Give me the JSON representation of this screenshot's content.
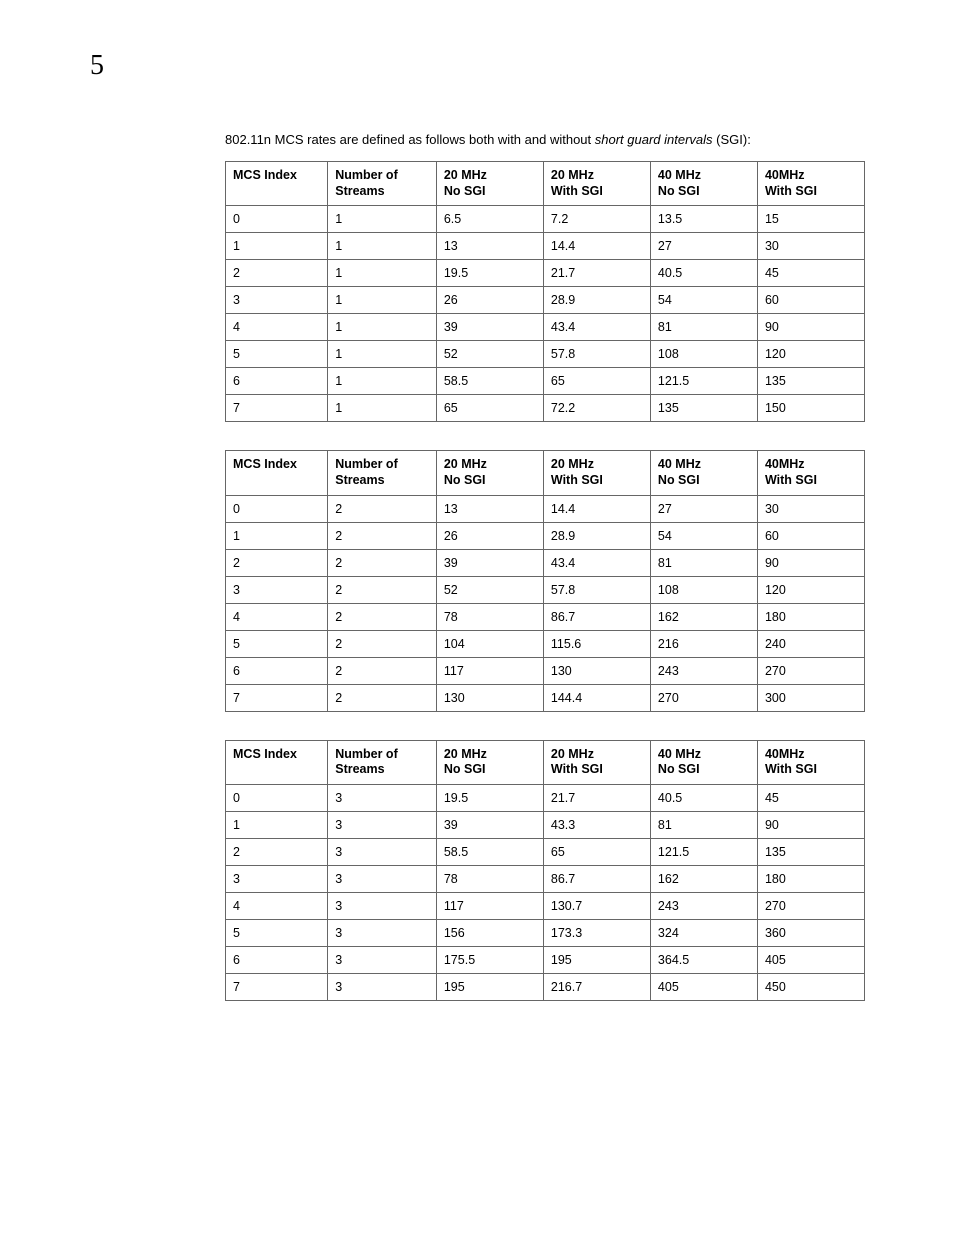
{
  "page_number": "5",
  "intro_prefix": "802.11n MCS rates are defined as follows both with and without ",
  "intro_em": "short guard intervals",
  "intro_suffix": " (SGI):",
  "columns": [
    {
      "l1": "MCS Index",
      "l2": ""
    },
    {
      "l1": "Number of Streams",
      "l2": ""
    },
    {
      "l1": "20 MHz",
      "l2": "No SGI"
    },
    {
      "l1": "20 MHz",
      "l2": "With SGI"
    },
    {
      "l1": "40 MHz",
      "l2": "No SGI"
    },
    {
      "l1": "40MHz",
      "l2": "With SGI"
    }
  ],
  "tables": [
    {
      "rows": [
        [
          "0",
          "1",
          "6.5",
          "7.2",
          "13.5",
          "15"
        ],
        [
          "1",
          "1",
          "13",
          "14.4",
          "27",
          "30"
        ],
        [
          "2",
          "1",
          "19.5",
          "21.7",
          "40.5",
          "45"
        ],
        [
          "3",
          "1",
          "26",
          "28.9",
          "54",
          "60"
        ],
        [
          "4",
          "1",
          "39",
          "43.4",
          "81",
          "90"
        ],
        [
          "5",
          "1",
          "52",
          "57.8",
          "108",
          "120"
        ],
        [
          "6",
          "1",
          "58.5",
          "65",
          "121.5",
          "135"
        ],
        [
          "7",
          "1",
          "65",
          "72.2",
          "135",
          "150"
        ]
      ]
    },
    {
      "rows": [
        [
          "0",
          "2",
          "13",
          "14.4",
          "27",
          "30"
        ],
        [
          "1",
          "2",
          "26",
          "28.9",
          "54",
          "60"
        ],
        [
          "2",
          "2",
          "39",
          "43.4",
          "81",
          "90"
        ],
        [
          "3",
          "2",
          "52",
          "57.8",
          "108",
          "120"
        ],
        [
          "4",
          "2",
          "78",
          "86.7",
          "162",
          "180"
        ],
        [
          "5",
          "2",
          "104",
          "115.6",
          "216",
          "240"
        ],
        [
          "6",
          "2",
          "117",
          "130",
          "243",
          "270"
        ],
        [
          "7",
          "2",
          "130",
          "144.4",
          "270",
          "300"
        ]
      ]
    },
    {
      "rows": [
        [
          "0",
          "3",
          "19.5",
          "21.7",
          "40.5",
          "45"
        ],
        [
          "1",
          "3",
          "39",
          "43.3",
          "81",
          "90"
        ],
        [
          "2",
          "3",
          "58.5",
          "65",
          "121.5",
          "135"
        ],
        [
          "3",
          "3",
          "78",
          "86.7",
          "162",
          "180"
        ],
        [
          "4",
          "3",
          "117",
          "130.7",
          "243",
          "270"
        ],
        [
          "5",
          "3",
          "156",
          "173.3",
          "324",
          "360"
        ],
        [
          "6",
          "3",
          "175.5",
          "195",
          "364.5",
          "405"
        ],
        [
          "7",
          "3",
          "195",
          "216.7",
          "405",
          "450"
        ]
      ]
    }
  ]
}
